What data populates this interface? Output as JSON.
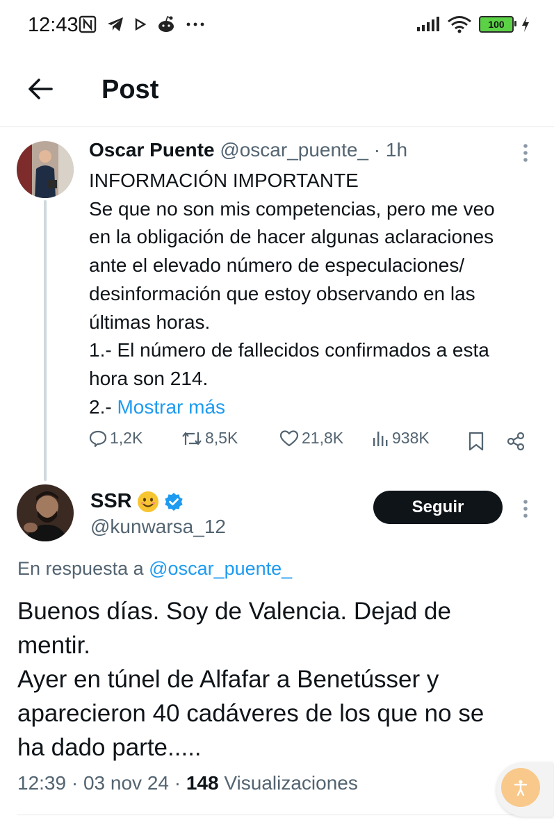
{
  "status_bar": {
    "time": "12:43",
    "icons": [
      "nfc-icon",
      "telegram-icon",
      "play-icon",
      "reddit-icon",
      "more-icon"
    ],
    "battery": "100"
  },
  "header": {
    "title": "Post"
  },
  "original_post": {
    "author_name": "Oscar Puente",
    "handle": "@oscar_puente_",
    "separator": "·",
    "time": "1h",
    "lines": [
      "INFORMACIÓN IMPORTANTE",
      "Se que no son mis competencias, pero me veo",
      "en la obligación de hacer algunas aclaraciones",
      "ante el elevado número de especulaciones/",
      "desinformación que estoy observando en las",
      "últimas horas.",
      "1.- El número de fallecidos confirmados a esta",
      "hora son 214."
    ],
    "last_line_prefix": "2.- ",
    "show_more": "Mostrar más",
    "stats": {
      "replies": "1,2K",
      "reposts": "8,5K",
      "likes": "21,8K",
      "views": "938K"
    }
  },
  "reply_post": {
    "author_name": "SSR",
    "handle": "@kunwarsa_12",
    "follow_label": "Seguir",
    "in_reply_prefix": "En respuesta a",
    "in_reply_handle": "@oscar_puente_",
    "lines": [
      "Buenos días. Soy de Valencia. Dejad de",
      "mentir.",
      "Ayer en túnel de Alfafar a Benetússer y",
      "aparecieron 40 cadáveres de los que no se",
      "ha dado parte....."
    ],
    "time": "12:39",
    "separator": "·",
    "date": "03 nov 24",
    "views_count": "148",
    "views_label": "Visualizaciones"
  },
  "colors": {
    "link": "#1d9bf0",
    "muted": "#536471",
    "verified": "#1d9bf0",
    "follow_bg": "#0f1419",
    "battery": "#5bd146"
  }
}
